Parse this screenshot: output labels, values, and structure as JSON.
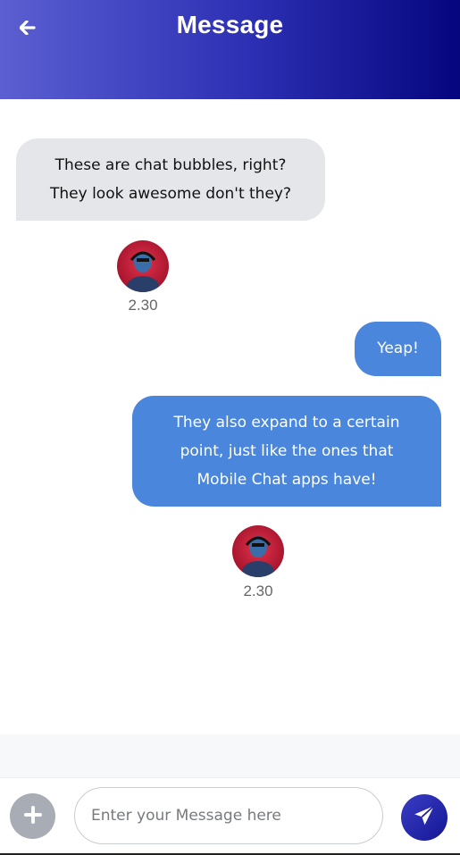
{
  "header": {
    "title": "Message",
    "back_icon": "arrow-left-icon",
    "gradient": [
      "#5b5fd1",
      "#05057e"
    ]
  },
  "messages": [
    {
      "direction": "incoming",
      "text": "These are chat bubbles, right?\nThey look awesome don't they?",
      "time": "2.30",
      "bubble_color": "#e5e6ea"
    },
    {
      "direction": "outgoing",
      "text": "Yeap!",
      "bubble_color": "#4a86dc"
    },
    {
      "direction": "outgoing",
      "text": "They also expand to a certain\npoint, just like the ones that\nMobile Chat apps have!",
      "time": "2.30",
      "bubble_color": "#4a86dc"
    }
  ],
  "composer": {
    "placeholder": "Enter your Message here",
    "value": "",
    "add_icon": "plus-icon",
    "send_icon": "paper-plane-icon"
  }
}
